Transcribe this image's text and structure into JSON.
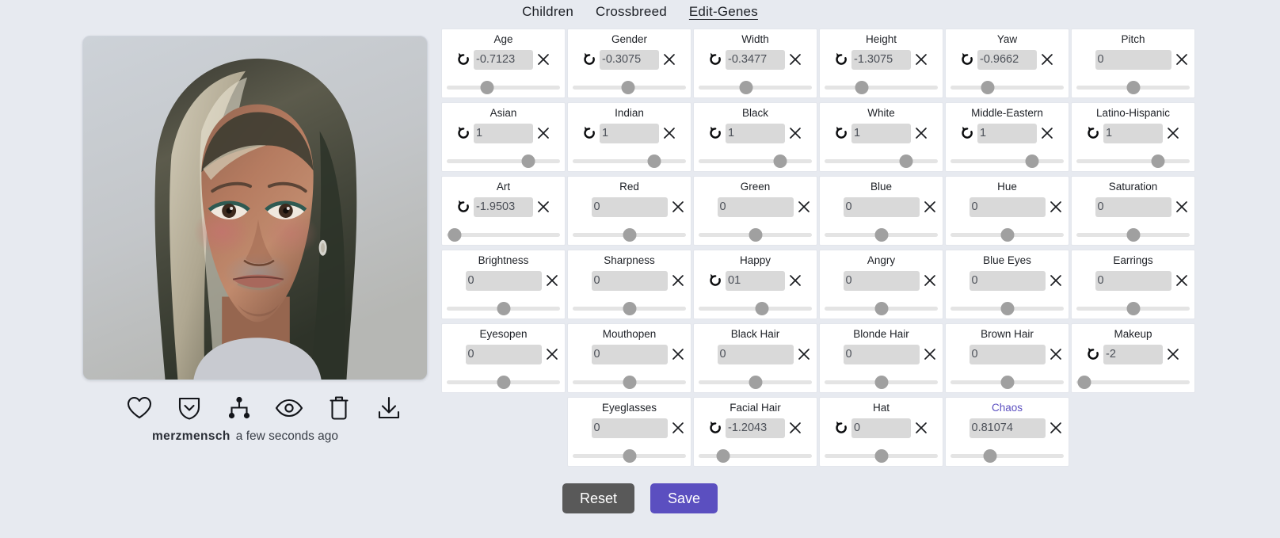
{
  "nav": {
    "items": [
      {
        "label": "Children",
        "active": false
      },
      {
        "label": "Crossbreed",
        "active": false
      },
      {
        "label": "Edit-Genes",
        "active": true
      }
    ]
  },
  "portrait": {
    "alt": "painted portrait of a woman with long dark hair",
    "author": "merzmensch",
    "timestamp": "a few seconds ago"
  },
  "toolbar": {
    "icons": [
      {
        "name": "heart-icon",
        "title": "Favorite"
      },
      {
        "name": "shield-down-icon",
        "title": "Save to collection"
      },
      {
        "name": "family-tree-icon",
        "title": "Lineage"
      },
      {
        "name": "eye-icon",
        "title": "View"
      },
      {
        "name": "trash-icon",
        "title": "Delete"
      },
      {
        "name": "download-icon",
        "title": "Download"
      }
    ]
  },
  "genes": [
    {
      "label": "Age",
      "value": "-0.7123",
      "reset": true,
      "clear": true,
      "slider": 0.36,
      "accent": false
    },
    {
      "label": "Gender",
      "value": "-0.3075",
      "reset": true,
      "clear": true,
      "slider": 0.49,
      "accent": false
    },
    {
      "label": "Width",
      "value": "-0.3477",
      "reset": true,
      "clear": true,
      "slider": 0.42,
      "accent": false
    },
    {
      "label": "Height",
      "value": "-1.3075",
      "reset": true,
      "clear": true,
      "slider": 0.33,
      "accent": false
    },
    {
      "label": "Yaw",
      "value": "-0.9662",
      "reset": true,
      "clear": true,
      "slider": 0.33,
      "accent": false
    },
    {
      "label": "Pitch",
      "value": "0",
      "reset": false,
      "clear": true,
      "slider": 0.5,
      "accent": false
    },
    {
      "label": "Asian",
      "value": "1",
      "reset": true,
      "clear": true,
      "slider": 0.72,
      "accent": false
    },
    {
      "label": "Indian",
      "value": "1",
      "reset": true,
      "clear": true,
      "slider": 0.72,
      "accent": false
    },
    {
      "label": "Black",
      "value": "1",
      "reset": true,
      "clear": true,
      "slider": 0.72,
      "accent": false
    },
    {
      "label": "White",
      "value": "1",
      "reset": true,
      "clear": true,
      "slider": 0.72,
      "accent": false
    },
    {
      "label": "Middle-Eastern",
      "value": "1",
      "reset": true,
      "clear": true,
      "slider": 0.72,
      "accent": false
    },
    {
      "label": "Latino-Hispanic",
      "value": "1",
      "reset": true,
      "clear": true,
      "slider": 0.72,
      "accent": false
    },
    {
      "label": "Art",
      "value": "-1.9503",
      "reset": true,
      "clear": true,
      "slider": 0.07,
      "accent": false
    },
    {
      "label": "Red",
      "value": "0",
      "reset": false,
      "clear": true,
      "slider": 0.5,
      "accent": false
    },
    {
      "label": "Green",
      "value": "0",
      "reset": false,
      "clear": true,
      "slider": 0.5,
      "accent": false
    },
    {
      "label": "Blue",
      "value": "0",
      "reset": false,
      "clear": true,
      "slider": 0.5,
      "accent": false
    },
    {
      "label": "Hue",
      "value": "0",
      "reset": false,
      "clear": true,
      "slider": 0.5,
      "accent": false
    },
    {
      "label": "Saturation",
      "value": "0",
      "reset": false,
      "clear": true,
      "slider": 0.5,
      "accent": false
    },
    {
      "label": "Brightness",
      "value": "0",
      "reset": false,
      "clear": true,
      "slider": 0.5,
      "accent": false
    },
    {
      "label": "Sharpness",
      "value": "0",
      "reset": false,
      "clear": true,
      "slider": 0.5,
      "accent": false
    },
    {
      "label": "Happy",
      "value": "01",
      "reset": true,
      "clear": true,
      "slider": 0.56,
      "accent": false
    },
    {
      "label": "Angry",
      "value": "0",
      "reset": false,
      "clear": true,
      "slider": 0.5,
      "accent": false
    },
    {
      "label": "Blue Eyes",
      "value": "0",
      "reset": false,
      "clear": true,
      "slider": 0.5,
      "accent": false
    },
    {
      "label": "Earrings",
      "value": "0",
      "reset": false,
      "clear": true,
      "slider": 0.5,
      "accent": false
    },
    {
      "label": "Eyesopen",
      "value": "0",
      "reset": false,
      "clear": true,
      "slider": 0.5,
      "accent": false
    },
    {
      "label": "Mouthopen",
      "value": "0",
      "reset": false,
      "clear": true,
      "slider": 0.5,
      "accent": false
    },
    {
      "label": "Black Hair",
      "value": "0",
      "reset": false,
      "clear": true,
      "slider": 0.5,
      "accent": false
    },
    {
      "label": "Blonde Hair",
      "value": "0",
      "reset": false,
      "clear": true,
      "slider": 0.5,
      "accent": false
    },
    {
      "label": "Brown Hair",
      "value": "0",
      "reset": false,
      "clear": true,
      "slider": 0.5,
      "accent": false
    },
    {
      "label": "Makeup",
      "value": "-2",
      "reset": true,
      "clear": true,
      "slider": 0.07,
      "accent": false
    },
    {
      "label": "",
      "value": "",
      "reset": false,
      "clear": false,
      "slider": 0.5,
      "accent": false,
      "empty": true
    },
    {
      "label": "Eyeglasses",
      "value": "0",
      "reset": false,
      "clear": true,
      "slider": 0.5,
      "accent": false
    },
    {
      "label": "Facial Hair",
      "value": "-1.2043",
      "reset": true,
      "clear": true,
      "slider": 0.22,
      "accent": false
    },
    {
      "label": "Hat",
      "value": "0",
      "reset": true,
      "clear": true,
      "slider": 0.5,
      "accent": false
    },
    {
      "label": "Chaos",
      "value": "0.81074",
      "reset": false,
      "clear": true,
      "slider": 0.35,
      "accent": true
    },
    {
      "label": "",
      "value": "",
      "reset": false,
      "clear": false,
      "slider": 0.5,
      "accent": false,
      "empty": true
    }
  ],
  "footer": {
    "reset_label": "Reset",
    "save_label": "Save"
  },
  "colors": {
    "background": "#e7eaf0",
    "accent": "#5b4fc0",
    "reset_button": "#595959",
    "input_bg": "#d9d9d9",
    "thumb": "#a0a0a0"
  }
}
